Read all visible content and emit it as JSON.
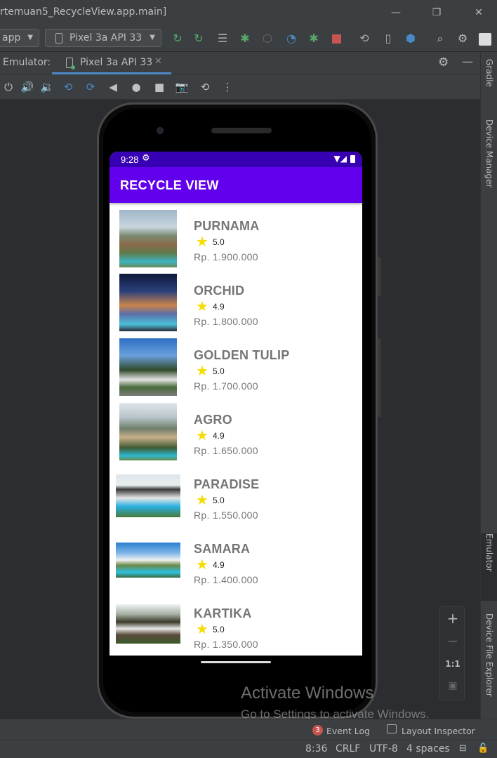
{
  "window": {
    "title": "rtemuan5_RecycleView.app.main]",
    "controls": [
      "minimize",
      "restore",
      "close"
    ]
  },
  "toolbar": {
    "module_combo": "app",
    "device_combo": "Pixel 3a API 33"
  },
  "emulator_tabs": {
    "label": "Emulator:",
    "active_tab": "Pixel 3a API 33"
  },
  "right_sidebar": {
    "gradle": "Gradle",
    "device_manager": "Device Manager",
    "emulator": "Emulator",
    "device_file_explorer": "Device File Explorer"
  },
  "phone": {
    "status_time": "9:28",
    "app_title": "RECYCLE VIEW",
    "hotels": [
      {
        "name": "PURNAMA",
        "rating": "5.0",
        "price": "Rp. 1.900.000"
      },
      {
        "name": "ORCHID",
        "rating": "4.9",
        "price": "Rp. 1.800.000"
      },
      {
        "name": "GOLDEN TULIP",
        "rating": "5.0",
        "price": "Rp. 1.700.000"
      },
      {
        "name": "AGRO",
        "rating": "4.9",
        "price": "Rp. 1.650.000"
      },
      {
        "name": "PARADISE",
        "rating": "5.0",
        "price": "Rp. 1.550.000"
      },
      {
        "name": "SAMARA",
        "rating": "4.9",
        "price": "Rp. 1.400.000"
      },
      {
        "name": "KARTIKA",
        "rating": "5.0",
        "price": "Rp. 1.350.000"
      }
    ]
  },
  "zoom": {
    "plus": "+",
    "minus": "−",
    "one_to_one": "1:1"
  },
  "watermark": {
    "line1": "Activate Windows",
    "line2": "Go to Settings to activate Windows."
  },
  "event_bar": {
    "event_count": "3",
    "event_log": "Event Log",
    "layout_inspector": "Layout Inspector"
  },
  "status_line": {
    "time": "8:36",
    "line_sep": "CRLF",
    "encoding": "UTF-8",
    "indent": "4 spaces"
  },
  "colors": {
    "status_bar": "#3700b3",
    "app_bar": "#6200ee",
    "star": "#f5dd00",
    "ide_bg": "#2b2d30",
    "ide_panel": "#3c3f41"
  }
}
